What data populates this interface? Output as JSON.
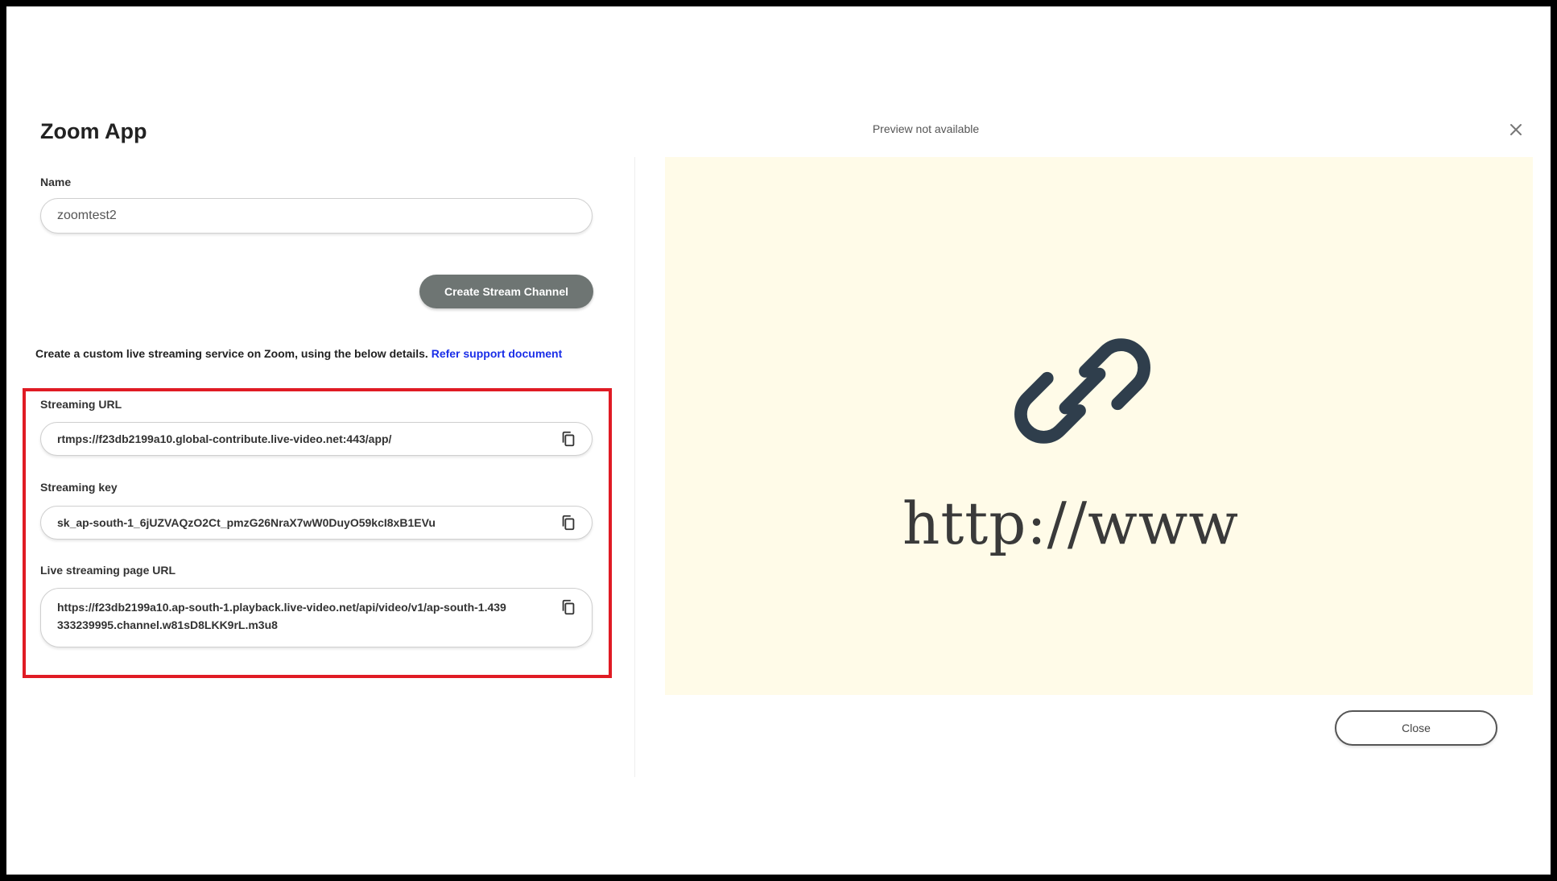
{
  "dialog": {
    "title": "Zoom App",
    "name_label": "Name",
    "name_value": "zoomtest2",
    "create_button": "Create Stream Channel",
    "description": "Create a custom live streaming service on Zoom, using the below details.",
    "support_link": "Refer support document",
    "fields": [
      {
        "label": "Streaming URL",
        "value": "rtmps://f23db2199a10.global-contribute.live-video.net:443/app/",
        "icon": "copy-icon"
      },
      {
        "label": "Streaming key",
        "value": "sk_ap-south-1_6jUZVAQzO2Ct_pmzG26NraX7wW0DuyO59kcI8xB1EVu",
        "icon": "copy-icon"
      },
      {
        "label": "Live streaming page URL",
        "value": "https://f23db2199a10.ap-south-1.playback.live-video.net/api/video/v1/ap-south-1.439333239995.channel.w81sD8LKK9rL.m3u8",
        "icon": "copy-icon"
      }
    ]
  },
  "preview": {
    "note": "Preview not available",
    "url_text": "http://www",
    "icon": "link-icon",
    "close_button": "Close",
    "close_icon": "close-icon"
  },
  "colors": {
    "highlight": "#e01b24",
    "link": "#1a2ee8",
    "preview_bg": "#fffbe8",
    "create_button_bg": "#6e7573",
    "link_icon": "#2f3e4c"
  }
}
